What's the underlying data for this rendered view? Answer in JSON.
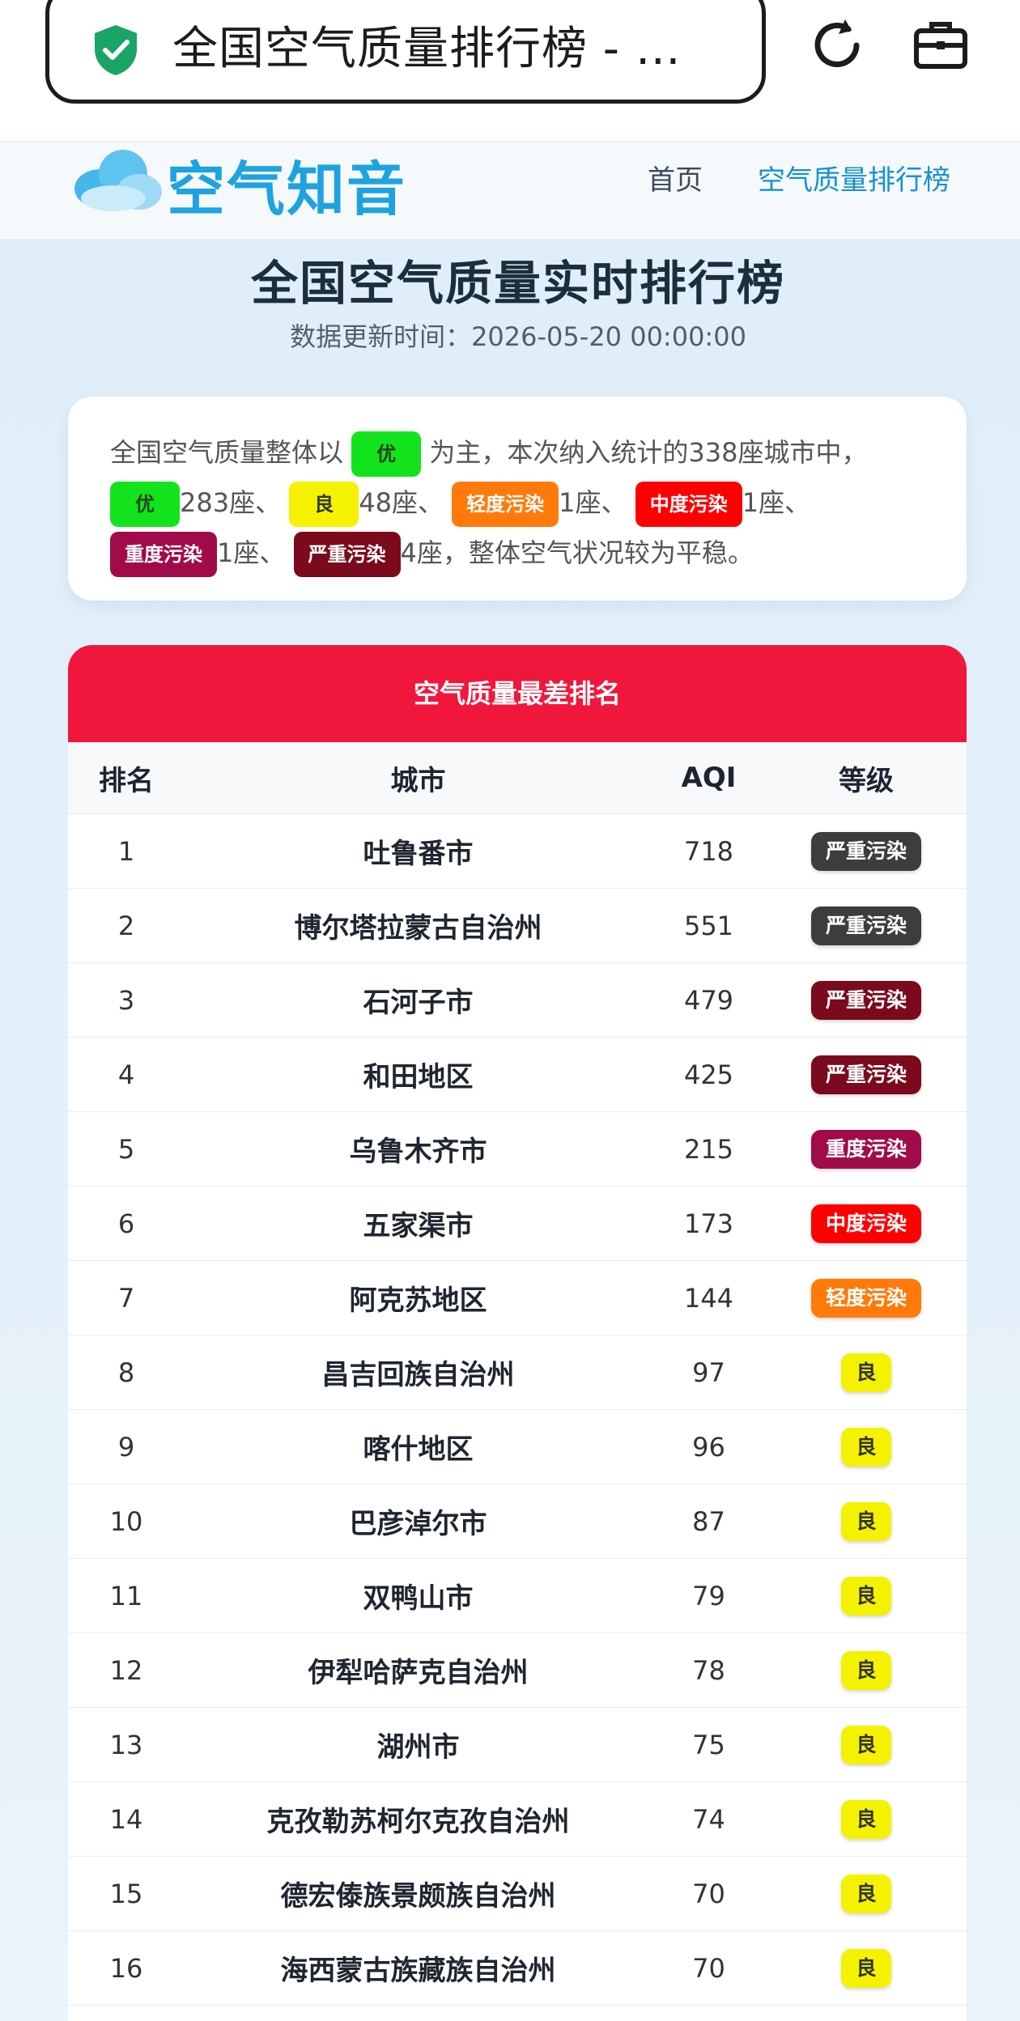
{
  "browser": {
    "url_title": "全国空气质量排行榜 - …",
    "icons": [
      "shield-check-icon",
      "reload-icon",
      "briefcase-icon"
    ]
  },
  "site": {
    "logo": "空气知音",
    "nav": [
      "首页",
      "空气质量排行榜"
    ]
  },
  "page": {
    "title": "全国空气质量实时排行榜",
    "update_time": "数据更新时间：2026-05-20 00:00:00"
  },
  "summary": {
    "prefix": "全国空气质量整体以",
    "main_level": "优",
    "middle": "为主，本次纳入统计的338座城市中，",
    "items": [
      {
        "level": "优",
        "count": "283座、"
      },
      {
        "level": "良",
        "count": "48座、"
      },
      {
        "level": "轻度污染",
        "count": "1座、"
      },
      {
        "level": "中度污染",
        "count": "1座、"
      },
      {
        "level": "重度污染",
        "count": "1座、"
      },
      {
        "level": "严重污染",
        "count": "4座，整体空气状况较为平稳。"
      }
    ]
  },
  "ranking": {
    "header": "空气质量最差排名",
    "columns": [
      "排名",
      "城市",
      "AQI",
      "等级"
    ],
    "rows": [
      {
        "rank": "1",
        "city": "吐鲁番市",
        "aqi": "718",
        "level": "严重污染",
        "color": "#3d3d3d"
      },
      {
        "rank": "2",
        "city": "博尔塔拉蒙古自治州",
        "aqi": "551",
        "level": "严重污染",
        "color": "#3d3d3d"
      },
      {
        "rank": "3",
        "city": "石河子市",
        "aqi": "479",
        "level": "严重污染",
        "color": "#7b0a1c"
      },
      {
        "rank": "4",
        "city": "和田地区",
        "aqi": "425",
        "level": "严重污染",
        "color": "#7b0a1c"
      },
      {
        "rank": "5",
        "city": "乌鲁木齐市",
        "aqi": "215",
        "level": "重度污染",
        "color": "#a10b49"
      },
      {
        "rank": "6",
        "city": "五家渠市",
        "aqi": "173",
        "level": "中度污染",
        "color": "#ff0000"
      },
      {
        "rank": "7",
        "city": "阿克苏地区",
        "aqi": "144",
        "level": "轻度污染",
        "color": "#ff7a0a"
      },
      {
        "rank": "8",
        "city": "昌吉回族自治州",
        "aqi": "97",
        "level": "良",
        "color": "#f5f200"
      },
      {
        "rank": "9",
        "city": "喀什地区",
        "aqi": "96",
        "level": "良",
        "color": "#f5f200"
      },
      {
        "rank": "10",
        "city": "巴彦淖尔市",
        "aqi": "87",
        "level": "良",
        "color": "#f5f200"
      },
      {
        "rank": "11",
        "city": "双鸭山市",
        "aqi": "79",
        "level": "良",
        "color": "#f5f200"
      },
      {
        "rank": "12",
        "city": "伊犁哈萨克自治州",
        "aqi": "78",
        "level": "良",
        "color": "#f5f200"
      },
      {
        "rank": "13",
        "city": "湖州市",
        "aqi": "75",
        "level": "良",
        "color": "#f5f200"
      },
      {
        "rank": "14",
        "city": "克孜勒苏柯尔克孜自治州",
        "aqi": "74",
        "level": "良",
        "color": "#f5f200"
      },
      {
        "rank": "15",
        "city": "德宏傣族景颇族自治州",
        "aqi": "70",
        "level": "良",
        "color": "#f5f200"
      },
      {
        "rank": "16",
        "city": "海西蒙古族藏族自治州",
        "aqi": "70",
        "level": "良",
        "color": "#f5f200"
      }
    ]
  }
}
